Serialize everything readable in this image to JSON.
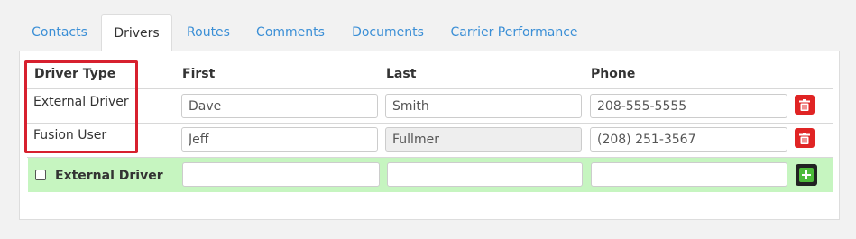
{
  "tabs": [
    {
      "label": "Contacts",
      "active": false
    },
    {
      "label": "Drivers",
      "active": true
    },
    {
      "label": "Routes",
      "active": false
    },
    {
      "label": "Comments",
      "active": false
    },
    {
      "label": "Documents",
      "active": false
    },
    {
      "label": "Carrier Performance",
      "active": false
    }
  ],
  "table": {
    "headers": {
      "driver_type": "Driver Type",
      "first": "First",
      "last": "Last",
      "phone": "Phone"
    },
    "rows": [
      {
        "driver_type": "External Driver",
        "first": "Dave",
        "last": "Smith",
        "phone": "208-555-5555",
        "last_disabled": false
      },
      {
        "driver_type": "Fusion User",
        "first": "Jeff",
        "last": "Fullmer",
        "phone": "(208) 251-3567",
        "last_disabled": true
      }
    ],
    "new_row": {
      "checkbox_label": "External Driver",
      "checked": false,
      "first": "",
      "last": "",
      "phone": ""
    }
  },
  "icons": {
    "delete": "trash-icon",
    "add": "plus-icon"
  },
  "colors": {
    "link": "#3b8fd6",
    "delete_button": "#e02424",
    "new_row_background": "#c6f5c0",
    "add_button": "#4dbb3a",
    "highlight_border": "#d7202e"
  }
}
